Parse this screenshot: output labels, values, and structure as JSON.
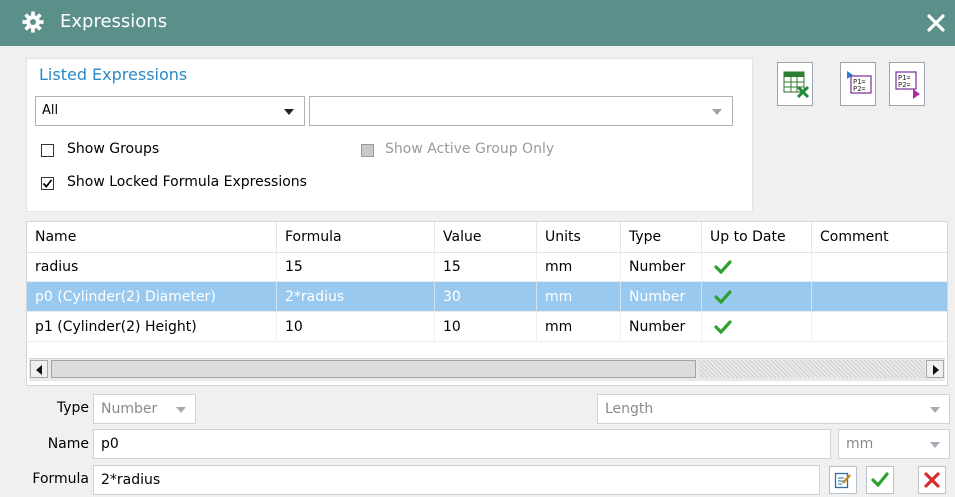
{
  "window": {
    "title": "Expressions",
    "icon": "gear-icon",
    "close_icon": "close-icon"
  },
  "listed": {
    "title": "Listed Expressions",
    "filter_value": "All",
    "search_value": "",
    "show_groups_label": "Show Groups",
    "show_groups_checked": false,
    "show_active_group_only_label": "Show Active Group Only",
    "show_active_group_only_enabled": false,
    "show_locked_label": "Show Locked Formula Expressions",
    "show_locked_checked": true
  },
  "toolbar": {
    "buttons": [
      {
        "name": "export-spreadsheet-icon"
      },
      {
        "name": "import-expressions-icon"
      },
      {
        "name": "export-expressions-icon"
      }
    ]
  },
  "table": {
    "columns": [
      "Name",
      "Formula",
      "Value",
      "Units",
      "Type",
      "Up to Date",
      "Comment"
    ],
    "rows": [
      {
        "name": "radius",
        "formula": "15",
        "value": "15",
        "units": "mm",
        "type": "Number",
        "up_to_date": true,
        "comment": "",
        "selected": false
      },
      {
        "name": "p0  (Cylinder(2) Diameter)",
        "formula": "2*radius",
        "value": "30",
        "units": "mm",
        "type": "Number",
        "up_to_date": true,
        "comment": "",
        "selected": true
      },
      {
        "name": "p1  (Cylinder(2) Height)",
        "formula": "10",
        "value": "10",
        "units": "mm",
        "type": "Number",
        "up_to_date": true,
        "comment": "",
        "selected": false
      }
    ]
  },
  "editor": {
    "type_label": "Type",
    "type_value": "Number",
    "dimensionality_value": "Length",
    "name_label": "Name",
    "name_value": "p0",
    "units_value": "mm",
    "formula_label": "Formula",
    "formula_value": "2*radius"
  },
  "colors": {
    "titlebar": "#5a8f8a",
    "accent": "#2b89c6",
    "selected_row": "#99c9ef",
    "ok_green": "#2fa02f",
    "cancel_red": "#d32f2f"
  }
}
